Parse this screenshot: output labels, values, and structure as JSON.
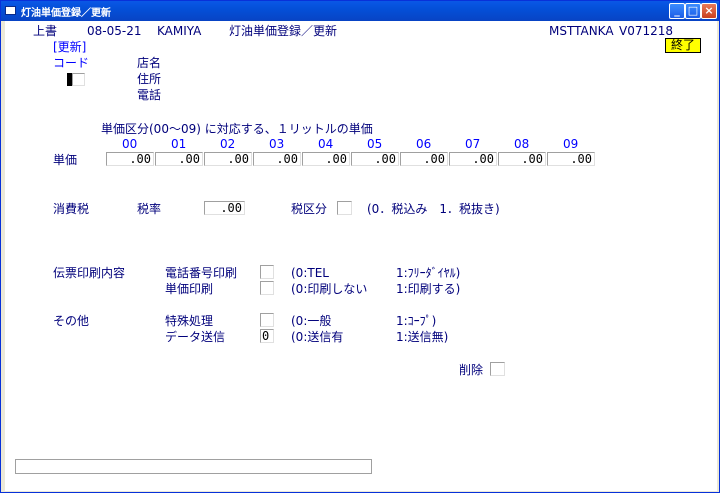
{
  "window": {
    "title": "灯油単価登録／更新"
  },
  "header": {
    "mode": "上書",
    "date": "08-05-21",
    "user": "KAMIYA",
    "screen_title": "灯油単価登録／更新",
    "program_id": "MSTTANKA",
    "version": "V071218",
    "exit_label": "終了"
  },
  "section_label": "[更新]",
  "customer": {
    "code_label": "コード",
    "store_label": "店名",
    "address_label": "住所",
    "phone_label": "電話"
  },
  "unit_price": {
    "heading": "単価区分(00～09) に対応する、１リットルの単価",
    "row_label": "単価",
    "columns": [
      {
        "code": "00",
        "value": ".00"
      },
      {
        "code": "01",
        "value": ".00"
      },
      {
        "code": "02",
        "value": ".00"
      },
      {
        "code": "03",
        "value": ".00"
      },
      {
        "code": "04",
        "value": ".00"
      },
      {
        "code": "05",
        "value": ".00"
      },
      {
        "code": "06",
        "value": ".00"
      },
      {
        "code": "07",
        "value": ".00"
      },
      {
        "code": "08",
        "value": ".00"
      },
      {
        "code": "09",
        "value": ".00"
      }
    ]
  },
  "tax": {
    "label": "消費税",
    "rate_label": "税率",
    "rate_value": ".00",
    "type_label": "税区分",
    "type_value": "",
    "type_hint": "(0．税込み　1．税抜き)"
  },
  "slip_print": {
    "label": "伝票印刷内容",
    "phone_print_label": "電話番号印刷",
    "phone_print_value": "",
    "phone_print_hint0": "(0:TEL",
    "phone_print_hint1": "1:ﾌﾘｰﾀﾞｲﾔﾙ)",
    "price_print_label": "単価印刷",
    "price_print_value": "",
    "price_print_hint0": "(0:印刷しない",
    "price_print_hint1": "1:印刷する)"
  },
  "other": {
    "label": "その他",
    "special_label": "特殊処理",
    "special_value": "",
    "special_hint0": "(0:一般",
    "special_hint1": "1:ｺｰﾌﾟ)",
    "send_label": "データ送信",
    "send_value": "0",
    "send_hint0": "(0:送信有",
    "send_hint1": "1:送信無)"
  },
  "delete": {
    "label": "削除",
    "value": ""
  },
  "status_bar": {
    "text": ""
  }
}
